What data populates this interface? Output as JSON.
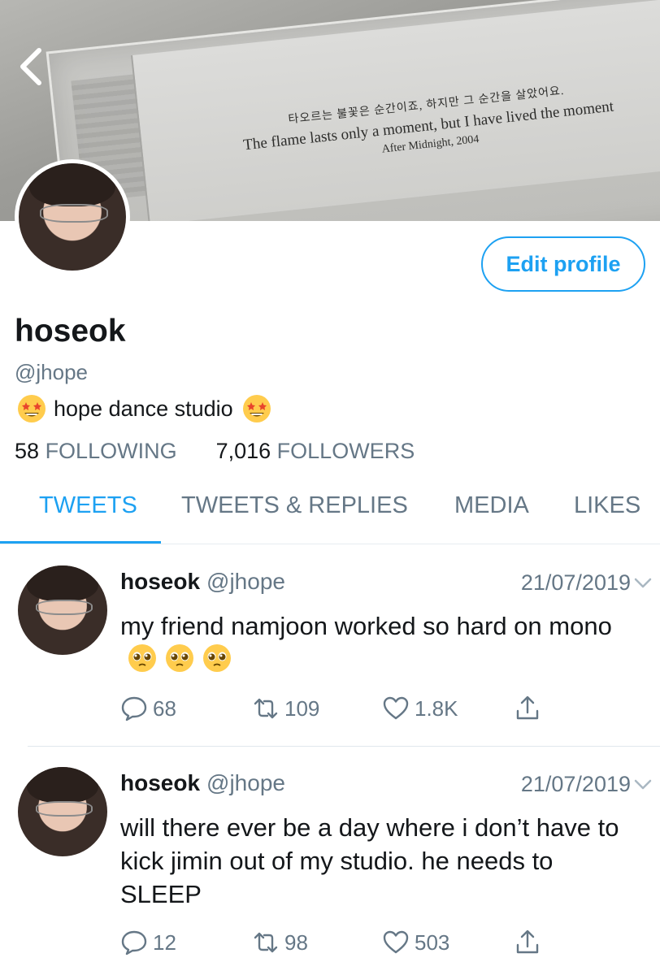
{
  "header": {
    "banner_text": {
      "korean": "타오르는 불꽃은 순간이죠, 하지만 그 순간을 살았어요.",
      "english": "The flame lasts only a moment, but I have lived the moment",
      "source": "After Midnight, 2004"
    }
  },
  "profile": {
    "edit_label": "Edit profile",
    "display_name": "hoseok",
    "handle": "@jhope",
    "bio": "hope dance studio",
    "following_count": "58",
    "following_label": "FOLLOWING",
    "followers_count": "7,016",
    "followers_label": "FOLLOWERS"
  },
  "tabs": [
    {
      "label": "TWEETS",
      "active": true
    },
    {
      "label": "TWEETS & REPLIES",
      "active": false
    },
    {
      "label": "MEDIA",
      "active": false
    },
    {
      "label": "LIKES",
      "active": false
    }
  ],
  "tweets": [
    {
      "name": "hoseok",
      "handle": "@jhope",
      "date": "21/07/2019",
      "text": "my friend namjoon worked so hard on mono",
      "replies": "68",
      "retweets": "109",
      "likes": "1.8K"
    },
    {
      "name": "hoseok",
      "handle": "@jhope",
      "date": "21/07/2019",
      "text": "will there ever be a day where i don’t have to kick jimin out of my studio. he needs to SLEEP",
      "replies": "12",
      "retweets": "98",
      "likes": "503"
    }
  ],
  "colors": {
    "accent": "#1da1f2",
    "secondary_text": "#657786",
    "primary_text": "#14171a"
  },
  "icons": [
    "back-chevron-icon",
    "star-struck-emoji-icon",
    "pleading-face-emoji-icon",
    "reply-icon",
    "retweet-icon",
    "like-heart-icon",
    "share-icon",
    "chevron-down-icon"
  ]
}
